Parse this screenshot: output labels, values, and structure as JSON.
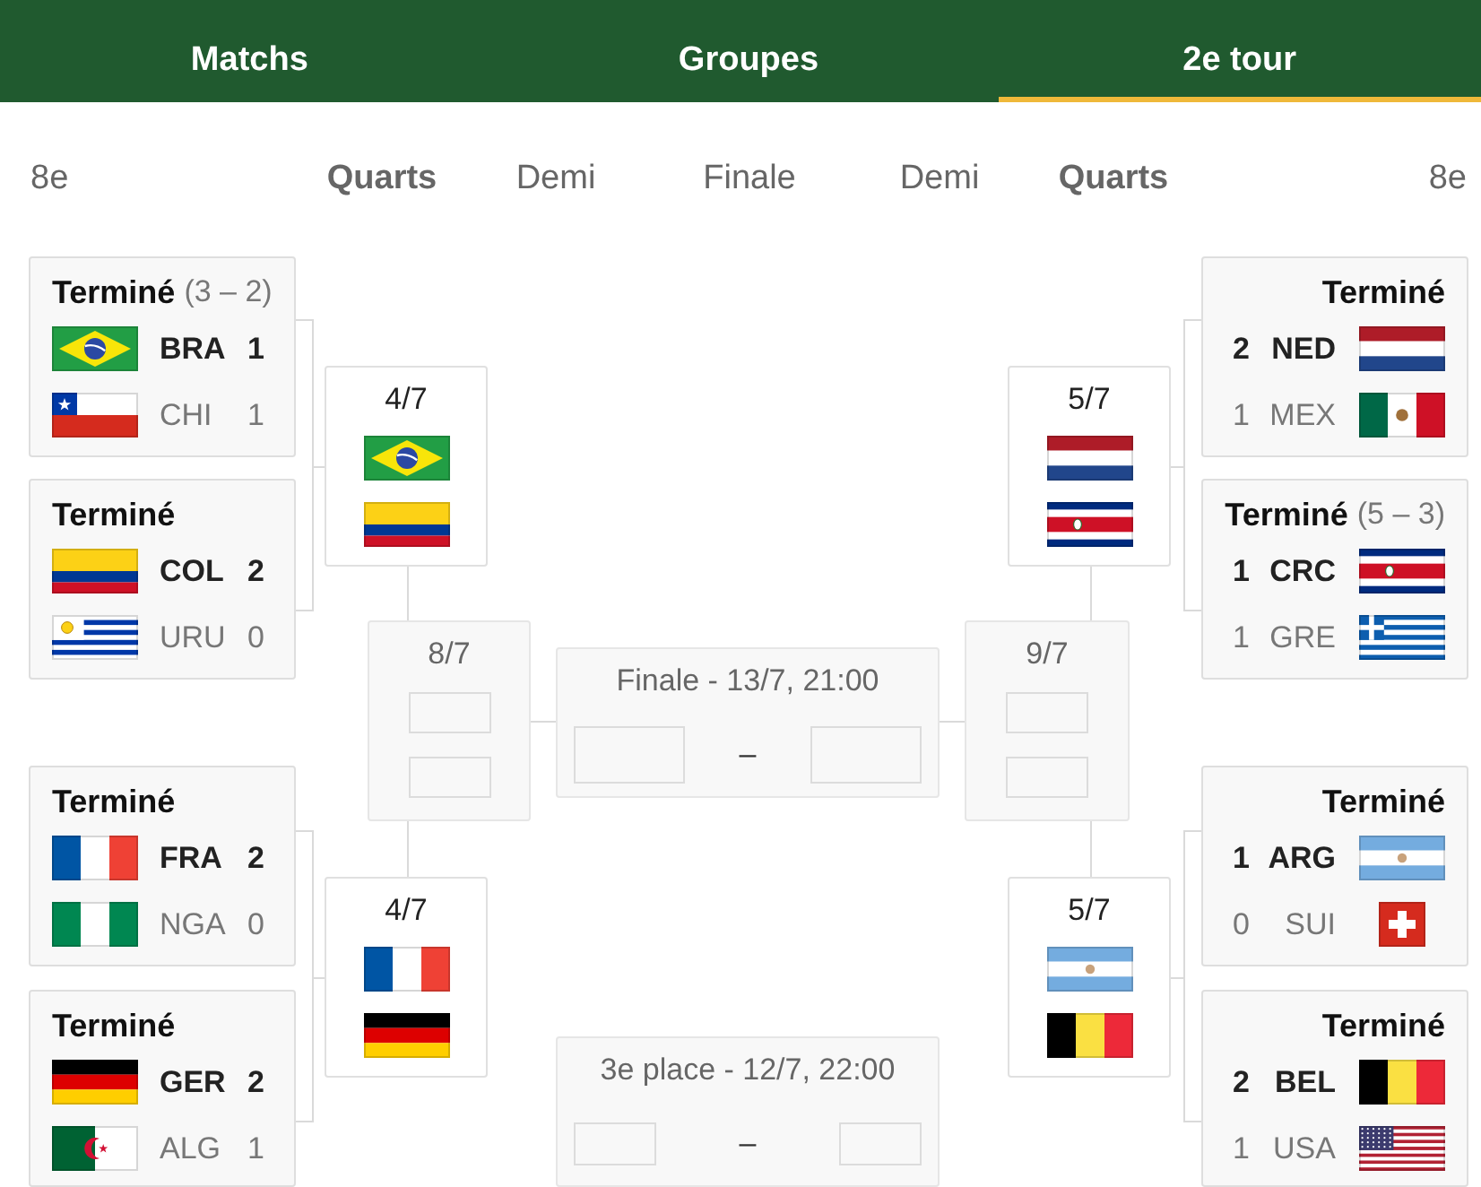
{
  "tabs": [
    {
      "label": "Matchs",
      "selected": false
    },
    {
      "label": "Groupes",
      "selected": false
    },
    {
      "label": "2e tour",
      "selected": true
    }
  ],
  "rounds": [
    {
      "label": "8e",
      "current": false
    },
    {
      "label": "Quarts",
      "current": true
    },
    {
      "label": "Demi",
      "current": false
    },
    {
      "label": "Finale",
      "current": false
    },
    {
      "label": "Demi",
      "current": false
    },
    {
      "label": "Quarts",
      "current": true
    },
    {
      "label": "8e",
      "current": false
    }
  ],
  "bracket": {
    "left": {
      "round_of_16": [
        {
          "status": "Terminé",
          "penalties": "(3 – 2)",
          "teams": [
            {
              "kind": "brazil",
              "code": "BRA",
              "score": "1",
              "winner": true
            },
            {
              "kind": "chile",
              "code": "CHI",
              "score": "1",
              "winner": false
            }
          ]
        },
        {
          "status": "Terminé",
          "teams": [
            {
              "kind": "colombia",
              "code": "COL",
              "score": "2",
              "winner": true
            },
            {
              "kind": "uruguay",
              "code": "URU",
              "score": "0",
              "winner": false
            }
          ]
        },
        {
          "status": "Terminé",
          "teams": [
            {
              "kind": "france",
              "code": "FRA",
              "score": "2",
              "winner": true
            },
            {
              "kind": "nigeria",
              "code": "NGA",
              "score": "0",
              "winner": false
            }
          ]
        },
        {
          "status": "Terminé",
          "teams": [
            {
              "kind": "germany",
              "code": "GER",
              "score": "2",
              "winner": true
            },
            {
              "kind": "algeria",
              "code": "ALG",
              "score": "1",
              "winner": false
            }
          ]
        }
      ],
      "quarterfinals": [
        {
          "date": "4/7",
          "teams": [
            {
              "kind": "brazil"
            },
            {
              "kind": "colombia"
            }
          ]
        },
        {
          "date": "4/7",
          "teams": [
            {
              "kind": "france"
            },
            {
              "kind": "germany"
            }
          ]
        }
      ],
      "semifinal": {
        "date": "8/7",
        "teams": [
          {
            "kind": "empty"
          },
          {
            "kind": "empty"
          }
        ]
      }
    },
    "final": {
      "title": "Finale - 13/7, 21:00",
      "separator": "–",
      "teams": [
        {
          "kind": "empty"
        },
        {
          "kind": "empty"
        }
      ]
    },
    "third_place": {
      "title": "3e place - 12/7, 22:00",
      "separator": "–",
      "teams": [
        {
          "kind": "empty"
        },
        {
          "kind": "empty"
        }
      ]
    },
    "right": {
      "round_of_16": [
        {
          "status": "Terminé",
          "teams": [
            {
              "kind": "netherlands",
              "code": "NED",
              "score": "2",
              "winner": true
            },
            {
              "kind": "mexico",
              "code": "MEX",
              "score": "1",
              "winner": false
            }
          ]
        },
        {
          "status": "Terminé",
          "penalties": "(5 – 3)",
          "teams": [
            {
              "kind": "costa_rica",
              "code": "CRC",
              "score": "1",
              "winner": true
            },
            {
              "kind": "greece",
              "code": "GRE",
              "score": "1",
              "winner": false
            }
          ]
        },
        {
          "status": "Terminé",
          "teams": [
            {
              "kind": "argentina",
              "code": "ARG",
              "score": "1",
              "winner": true
            },
            {
              "kind": "switzerland",
              "code": "SUI",
              "score": "0",
              "winner": false
            }
          ]
        },
        {
          "status": "Terminé",
          "teams": [
            {
              "kind": "belgium",
              "code": "BEL",
              "score": "2",
              "winner": true
            },
            {
              "kind": "usa",
              "code": "USA",
              "score": "1",
              "winner": false
            }
          ]
        }
      ],
      "quarterfinals": [
        {
          "date": "5/7",
          "teams": [
            {
              "kind": "netherlands"
            },
            {
              "kind": "costa_rica"
            }
          ]
        },
        {
          "date": "5/7",
          "teams": [
            {
              "kind": "argentina"
            },
            {
              "kind": "belgium"
            }
          ]
        }
      ],
      "semifinal": {
        "date": "9/7",
        "teams": [
          {
            "kind": "empty"
          },
          {
            "kind": "empty"
          }
        ]
      }
    }
  }
}
